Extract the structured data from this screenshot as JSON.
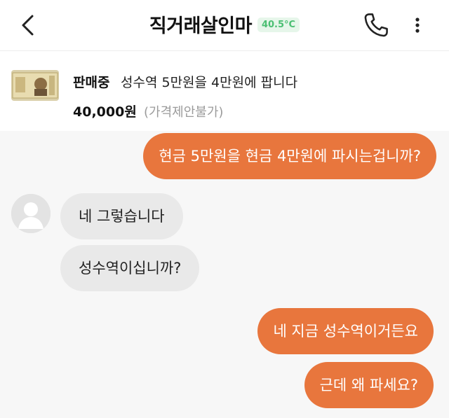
{
  "header": {
    "title": "직거래살인마",
    "temperature": "40.5°C",
    "icons": {
      "back": "chevron-left-icon",
      "call": "phone-icon",
      "more": "more-vertical-icon"
    }
  },
  "product": {
    "status": "판매중",
    "title": "성수역 5만원을 4만원에 팝니다",
    "price": "40,000원",
    "price_note": "(가격제안불가)"
  },
  "messages": [
    {
      "from": "me",
      "text": "현금 5만원을 현금 4만원에 파시는겁니까?"
    },
    {
      "from": "other",
      "text": "네 그렇습니다"
    },
    {
      "from": "other",
      "text": "성수역이십니까?"
    },
    {
      "from": "me",
      "text": "네 지금 성수역이거든요"
    },
    {
      "from": "me",
      "text": "근데 왜 파세요?"
    }
  ],
  "colors": {
    "my_bubble": "#e8763d",
    "other_bubble": "#e9e9e9",
    "chat_background": "#f7f7f7",
    "temp_badge_text": "#4bbf73"
  }
}
